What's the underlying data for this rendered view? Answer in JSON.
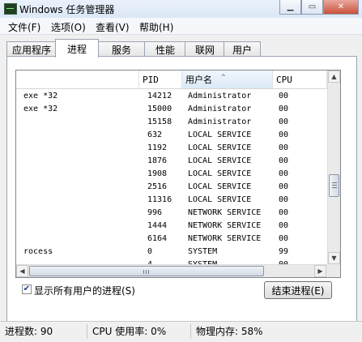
{
  "window": {
    "title": "Windows 任务管理器",
    "minimize_glyph": "▁",
    "maximize_glyph": "▭",
    "close_glyph": "✕"
  },
  "menu": [
    "文件(F)",
    "选项(O)",
    "查看(V)",
    "帮助(H)"
  ],
  "tabs": {
    "items": [
      "应用程序",
      "进程",
      "服务",
      "性能",
      "联网",
      "用户"
    ],
    "active": "进程"
  },
  "process_table": {
    "columns": {
      "name": "",
      "pid": "PID",
      "user": "用户名",
      "cpu": "CPU"
    },
    "sorted_column": "用户名",
    "sort_arrow": "^",
    "rows": [
      {
        "name": "exe *32",
        "pid": "14212",
        "user": "Administrator",
        "cpu": "00"
      },
      {
        "name": "exe *32",
        "pid": "15000",
        "user": "Administrator",
        "cpu": "00"
      },
      {
        "name": "",
        "pid": "15158",
        "user": "Administrator",
        "cpu": "00"
      },
      {
        "name": "",
        "pid": "632",
        "user": "LOCAL SERVICE",
        "cpu": "00"
      },
      {
        "name": "",
        "pid": "1192",
        "user": "LOCAL SERVICE",
        "cpu": "00"
      },
      {
        "name": "",
        "pid": "1876",
        "user": "LOCAL SERVICE",
        "cpu": "00"
      },
      {
        "name": "",
        "pid": "1908",
        "user": "LOCAL SERVICE",
        "cpu": "00"
      },
      {
        "name": "",
        "pid": "2516",
        "user": "LOCAL SERVICE",
        "cpu": "00"
      },
      {
        "name": "",
        "pid": "11316",
        "user": "LOCAL SERVICE",
        "cpu": "00"
      },
      {
        "name": "",
        "pid": "996",
        "user": "NETWORK SERVICE",
        "cpu": "00"
      },
      {
        "name": "",
        "pid": "1444",
        "user": "NETWORK SERVICE",
        "cpu": "00"
      },
      {
        "name": "",
        "pid": "6164",
        "user": "NETWORK SERVICE",
        "cpu": "00"
      },
      {
        "name": "rocess",
        "pid": "0",
        "user": "SYSTEM",
        "cpu": "99"
      },
      {
        "name": "",
        "pid": "4",
        "user": "SYSTEM",
        "cpu": "00"
      }
    ]
  },
  "scrollbar": {
    "up_glyph": "▲",
    "down_glyph": "▼",
    "left_glyph": "◀",
    "right_glyph": "▶"
  },
  "show_all_users": {
    "label": "显示所有用户的进程(S)",
    "checked": true,
    "check_glyph": "✔"
  },
  "end_process_button": "结束进程(E)",
  "status": {
    "processes": "进程数: 90",
    "cpu_usage": "CPU 使用率: 0%",
    "physical_memory": "物理内存: 58%"
  }
}
